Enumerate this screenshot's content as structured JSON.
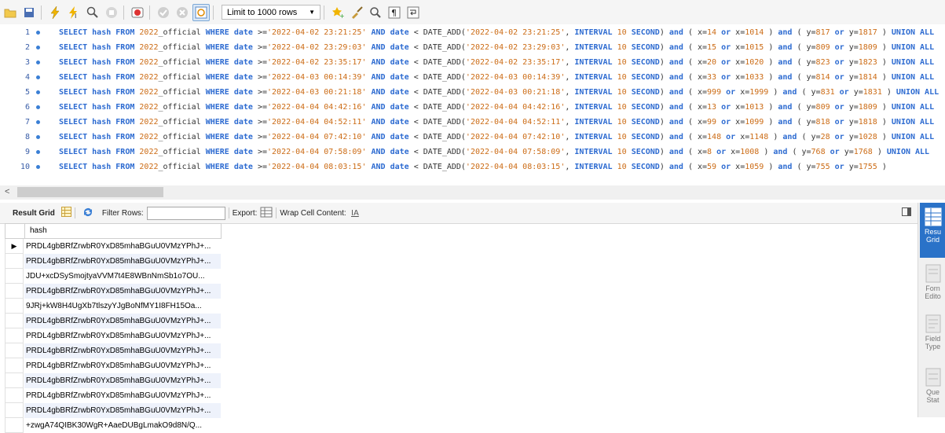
{
  "toolbar": {
    "limit_label": "Limit to 1000 rows",
    "buttons": [
      "folder",
      "save",
      "execute",
      "execute-current",
      "explain",
      "stop",
      "toggle-continue",
      "commit",
      "rollback",
      "toggle-autocommit",
      "limit",
      "favorite",
      "beautify",
      "find",
      "invisible-chars",
      "wrap"
    ]
  },
  "editor": {
    "lines": [
      {
        "num": "1",
        "dates": [
          "2022-04-02 23:21:25",
          "2022-04-02 23:21:25"
        ],
        "x": [
          "14",
          "1014"
        ],
        "y": [
          "817",
          "1817"
        ],
        "tail": " UNION ALL"
      },
      {
        "num": "2",
        "dates": [
          "2022-04-02 23:29:03",
          "2022-04-02 23:29:03"
        ],
        "x": [
          "15",
          "1015"
        ],
        "y": [
          "809",
          "1809"
        ],
        "tail": " UNION ALL"
      },
      {
        "num": "3",
        "dates": [
          "2022-04-02 23:35:17",
          "2022-04-02 23:35:17"
        ],
        "x": [
          "20",
          "1020"
        ],
        "y": [
          "823",
          "1823"
        ],
        "tail": " UNION ALL"
      },
      {
        "num": "4",
        "dates": [
          "2022-04-03 00:14:39",
          "2022-04-03 00:14:39"
        ],
        "x": [
          "33",
          "1033"
        ],
        "y": [
          "814",
          "1814"
        ],
        "tail": " UNION ALL"
      },
      {
        "num": "5",
        "dates": [
          "2022-04-03 00:21:18",
          "2022-04-03 00:21:18"
        ],
        "x": [
          "999",
          "1999"
        ],
        "y": [
          "831",
          "1831"
        ],
        "tail": " UNION ALL"
      },
      {
        "num": "6",
        "dates": [
          "2022-04-04 04:42:16",
          "2022-04-04 04:42:16"
        ],
        "x": [
          "13",
          "1013"
        ],
        "y": [
          "809",
          "1809"
        ],
        "tail": " UNION ALL"
      },
      {
        "num": "7",
        "dates": [
          "2022-04-04 04:52:11",
          "2022-04-04 04:52:11"
        ],
        "x": [
          "99",
          "1099"
        ],
        "y": [
          "818",
          "1818"
        ],
        "tail": " UNION ALL"
      },
      {
        "num": "8",
        "dates": [
          "2022-04-04 07:42:10",
          "2022-04-04 07:42:10"
        ],
        "x": [
          "148",
          "1148"
        ],
        "y": [
          "28",
          "1028"
        ],
        "tail": " UNION ALL"
      },
      {
        "num": "9",
        "dates": [
          "2022-04-04 07:58:09",
          "2022-04-04 07:58:09"
        ],
        "x": [
          "8",
          "1008"
        ],
        "y": [
          "768",
          "1768"
        ],
        "tail": " UNION ALL"
      },
      {
        "num": "10",
        "dates": [
          "2022-04-04 08:03:15",
          "2022-04-04 08:03:15"
        ],
        "x": [
          "59",
          "1059"
        ],
        "y": [
          "755",
          "1755"
        ],
        "tail": ""
      }
    ],
    "tokens": {
      "select": "SELECT",
      "hash": "hash",
      "from": "FROM",
      "table_num": "2022",
      "table_rest": "_official",
      "where": "WHERE",
      "date": "date",
      "and": "AND",
      "date_add": "DATE_ADD",
      "interval": "INTERVAL",
      "ten": "10",
      "second": "SECOND",
      "and_lower": "and",
      "or": "or"
    }
  },
  "result_bar": {
    "result_grid": "Result Grid",
    "filter_rows": "Filter Rows:",
    "export": "Export:",
    "wrap": "Wrap Cell Content:"
  },
  "grid": {
    "column": "hash",
    "rows": [
      "PRDL4gbBRfZrwbR0YxD85mhaBGuU0VMzYPhJ+...",
      "PRDL4gbBRfZrwbR0YxD85mhaBGuU0VMzYPhJ+...",
      "JDU+xcDSySmojtyaVVM7t4E8WBnNmSb1o7OU...",
      "PRDL4gbBRfZrwbR0YxD85mhaBGuU0VMzYPhJ+...",
      "9JRj+kW8H4UgXb7tlszyYJgBoNfMY1I8FH15Oa...",
      "PRDL4gbBRfZrwbR0YxD85mhaBGuU0VMzYPhJ+...",
      "PRDL4gbBRfZrwbR0YxD85mhaBGuU0VMzYPhJ+...",
      "PRDL4gbBRfZrwbR0YxD85mhaBGuU0VMzYPhJ+...",
      "PRDL4gbBRfZrwbR0YxD85mhaBGuU0VMzYPhJ+...",
      "PRDL4gbBRfZrwbR0YxD85mhaBGuU0VMzYPhJ+...",
      "PRDL4gbBRfZrwbR0YxD85mhaBGuU0VMzYPhJ+...",
      "PRDL4gbBRfZrwbR0YxD85mhaBGuU0VMzYPhJ+...",
      "+zwgA74QIBK30WgR+AaeDUBgLmakO9d8N/Q..."
    ]
  },
  "right_panel": {
    "items": [
      {
        "label1": "Resu",
        "label2": "Grid"
      },
      {
        "label1": "Forn",
        "label2": "Edito"
      },
      {
        "label1": "Field",
        "label2": "Type"
      },
      {
        "label1": "Que",
        "label2": "Stat"
      }
    ]
  }
}
